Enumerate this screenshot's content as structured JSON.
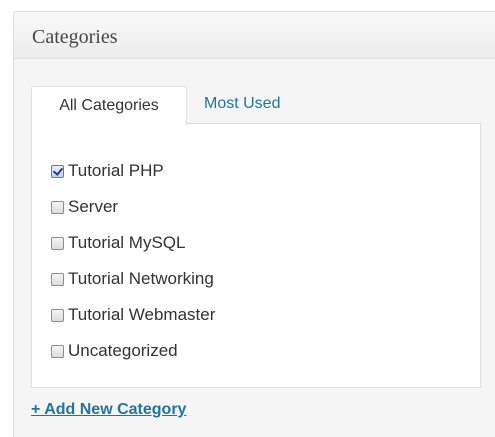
{
  "box": {
    "title": "Categories"
  },
  "tabs": {
    "all_label": "All Categories",
    "most_used_label": "Most Used"
  },
  "categories": [
    {
      "label": "Tutorial PHP",
      "checked": true
    },
    {
      "label": "Server",
      "checked": false
    },
    {
      "label": "Tutorial MySQL",
      "checked": false
    },
    {
      "label": "Tutorial Networking",
      "checked": false
    },
    {
      "label": "Tutorial Webmaster",
      "checked": false
    },
    {
      "label": "Uncategorized",
      "checked": false
    }
  ],
  "add_new": {
    "label": "+ Add New Category"
  },
  "colors": {
    "link": "#21759b",
    "border": "#dfdfdf",
    "background": "#f5f5f5"
  }
}
